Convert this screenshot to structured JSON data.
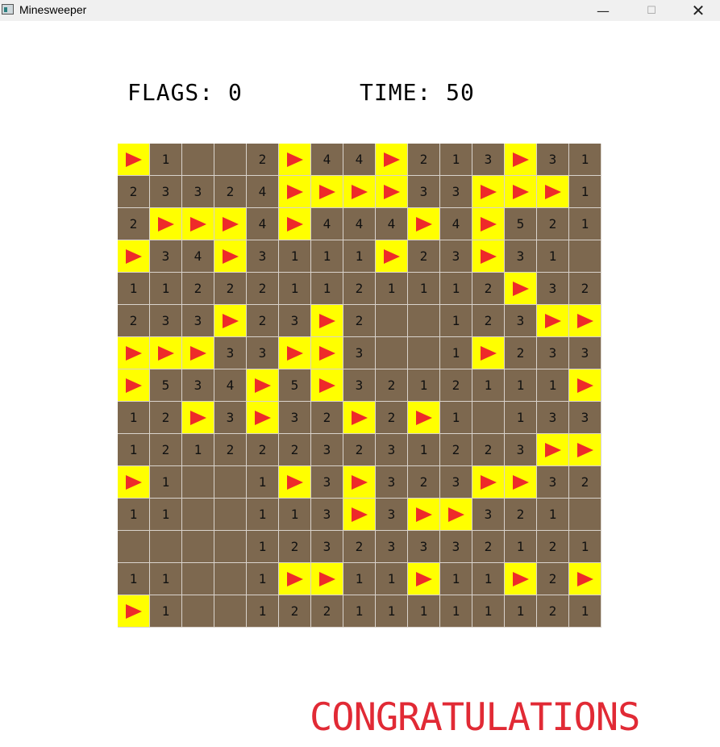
{
  "window": {
    "title": "Minesweeper"
  },
  "hud": {
    "flags": "FLAGS: 0",
    "time": "TIME: 50"
  },
  "colors": {
    "hidden_cell": "#7d684f",
    "flag_cell": "#ffff00",
    "flag": "#ee2a2a",
    "congrats": "#e12a35"
  },
  "board": {
    "rows": 15,
    "cols": 15,
    "cells": [
      [
        "F",
        "1",
        "",
        "",
        "2",
        "F",
        "4",
        "4",
        "F",
        "2",
        "1",
        "3",
        "F",
        "3",
        "1"
      ],
      [
        "2",
        "3",
        "3",
        "2",
        "4",
        "F",
        "F",
        "F",
        "F",
        "3",
        "3",
        "F",
        "F",
        "F",
        "1"
      ],
      [
        "2",
        "F",
        "F",
        "F",
        "4",
        "F",
        "4",
        "4",
        "4",
        "F",
        "4",
        "F",
        "5",
        "2",
        "1"
      ],
      [
        "F",
        "3",
        "4",
        "F",
        "3",
        "1",
        "1",
        "1",
        "F",
        "2",
        "3",
        "F",
        "3",
        "1",
        ""
      ],
      [
        "1",
        "1",
        "2",
        "2",
        "2",
        "1",
        "1",
        "2",
        "1",
        "1",
        "1",
        "2",
        "F",
        "3",
        "2"
      ],
      [
        "2",
        "3",
        "3",
        "F",
        "2",
        "3",
        "F",
        "2",
        "",
        "",
        "1",
        "2",
        "3",
        "F",
        "F"
      ],
      [
        "F",
        "F",
        "F",
        "3",
        "3",
        "F",
        "F",
        "3",
        "",
        "",
        "1",
        "F",
        "2",
        "3",
        "3"
      ],
      [
        "F",
        "5",
        "3",
        "4",
        "F",
        "5",
        "F",
        "3",
        "2",
        "1",
        "2",
        "1",
        "1",
        "1",
        "F"
      ],
      [
        "1",
        "2",
        "F",
        "3",
        "F",
        "3",
        "2",
        "F",
        "2",
        "F",
        "1",
        "",
        "1",
        "3",
        "3"
      ],
      [
        "1",
        "2",
        "1",
        "2",
        "2",
        "2",
        "3",
        "2",
        "3",
        "1",
        "2",
        "2",
        "3",
        "F",
        "F"
      ],
      [
        "F",
        "1",
        "",
        "",
        "1",
        "F",
        "3",
        "F",
        "3",
        "2",
        "3",
        "F",
        "F",
        "3",
        "2"
      ],
      [
        "1",
        "1",
        "",
        "",
        "1",
        "1",
        "3",
        "F",
        "3",
        "F",
        "F",
        "3",
        "2",
        "1",
        ""
      ],
      [
        "",
        "",
        "",
        "",
        "1",
        "2",
        "3",
        "2",
        "3",
        "3",
        "3",
        "2",
        "1",
        "2",
        "1"
      ],
      [
        "1",
        "1",
        "",
        "",
        "1",
        "F",
        "F",
        "1",
        "1",
        "F",
        "1",
        "1",
        "F",
        "2",
        "F"
      ],
      [
        "F",
        "1",
        "",
        "",
        "1",
        "2",
        "2",
        "1",
        "1",
        "1",
        "1",
        "1",
        "1",
        "2",
        "1"
      ]
    ]
  },
  "message": "CONGRATULATIONS"
}
